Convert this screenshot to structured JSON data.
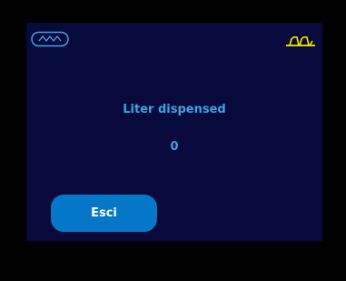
{
  "icons": {
    "left": "wave-icon",
    "right": "footwear-icon"
  },
  "colors": {
    "screen_background": "#070a3a",
    "text_accent": "#3ea4e6",
    "button_background": "#0577c9",
    "left_icon": "#3ea4e6",
    "right_icon": "#ffee00"
  },
  "main": {
    "title": "Liter dispensed",
    "value": "0"
  },
  "actions": {
    "exit_label": "Esci"
  }
}
